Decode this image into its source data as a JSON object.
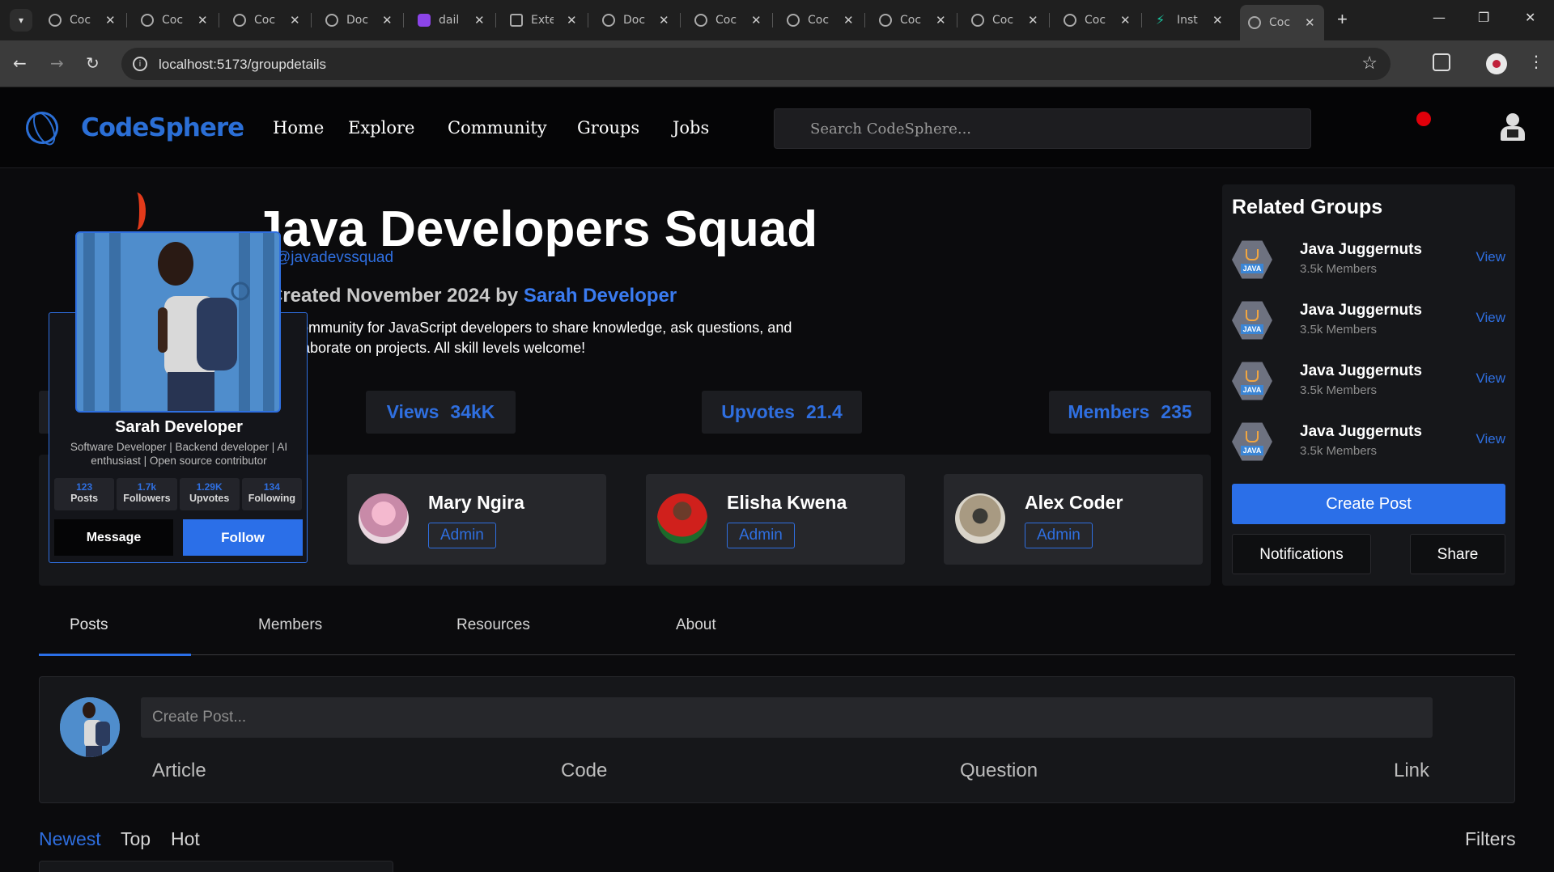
{
  "browser": {
    "tabs": [
      {
        "label": "Coc",
        "icon": "globe-icon"
      },
      {
        "label": "Coc",
        "icon": "globe-icon"
      },
      {
        "label": "Coc",
        "icon": "globe-icon"
      },
      {
        "label": "Doc",
        "icon": "globe-icon"
      },
      {
        "label": "dail",
        "icon": "app-icon"
      },
      {
        "label": "Exte",
        "icon": "puzzle-icon"
      },
      {
        "label": "Doc",
        "icon": "globe-icon"
      },
      {
        "label": "Coc",
        "icon": "globe-icon"
      },
      {
        "label": "Coc",
        "icon": "globe-icon"
      },
      {
        "label": "Coc",
        "icon": "globe-icon"
      },
      {
        "label": "Coc",
        "icon": "globe-icon"
      },
      {
        "label": "Coc",
        "icon": "globe-icon"
      },
      {
        "label": "Inst",
        "icon": "bolt-icon"
      },
      {
        "label": "Coc",
        "icon": "globe-icon",
        "active": true
      }
    ],
    "url": "localhost:5173/groupdetails"
  },
  "app": {
    "brand": "CodeSphere",
    "nav": [
      "Home",
      "Explore",
      "Community",
      "Groups",
      "Jobs"
    ],
    "search_placeholder": "Search CodeSphere..."
  },
  "group": {
    "title": "Java Developers Squad",
    "handle": "@javadevssquad",
    "created_prefix": "Created November 2024 by ",
    "created_by": "Sarah Developer",
    "description": "A community for JavaScript developers to share knowledge, ask questions, and collaborate on projects. All skill levels welcome!",
    "stats": [
      {
        "label": "Views",
        "value": "34kK"
      },
      {
        "label": "Upvotes",
        "value": "21.4"
      },
      {
        "label": "Members",
        "value": "235"
      }
    ],
    "admins": [
      {
        "name": "Mary Ngira",
        "role": "Admin"
      },
      {
        "name": "Elisha Kwena",
        "role": "Admin"
      },
      {
        "name": "Alex Coder",
        "role": "Admin"
      }
    ]
  },
  "profile_card": {
    "name": "Sarah Developer",
    "bio": "Software Developer | Backend developer | AI enthusiast | Open source contributor",
    "stats": [
      {
        "value": "123",
        "label": "Posts"
      },
      {
        "value": "1.7k",
        "label": "Followers"
      },
      {
        "value": "1.29K",
        "label": "Upvotes"
      },
      {
        "value": "134",
        "label": "Following"
      }
    ],
    "message_label": "Message",
    "follow_label": "Follow"
  },
  "sidebar": {
    "title": "Related Groups",
    "groups": [
      {
        "name": "Java Juggernuts",
        "members": "3.5k Members",
        "action": "View"
      },
      {
        "name": "Java Juggernuts",
        "members": "3.5k Members",
        "action": "View"
      },
      {
        "name": "Java Juggernuts",
        "members": "3.5k Members",
        "action": "View"
      },
      {
        "name": "Java Juggernuts",
        "members": "3.5k Members",
        "action": "View"
      }
    ],
    "create_post": "Create Post",
    "notifications": "Notifications",
    "share": "Share",
    "badge_text": "JAVA"
  },
  "tabs": [
    "Posts",
    "Members",
    "Resources",
    "About"
  ],
  "composer": {
    "placeholder": "Create Post...",
    "options": [
      "Article",
      "Code",
      "Question",
      "Link"
    ]
  },
  "sort": {
    "options": [
      "Newest",
      "Top",
      "Hot"
    ],
    "active": "Newest",
    "filters": "Filters"
  },
  "colors": {
    "accent": "#2b6fe8",
    "background": "#0b0b0d",
    "panel": "#16171a",
    "notification": "#e0000a"
  }
}
